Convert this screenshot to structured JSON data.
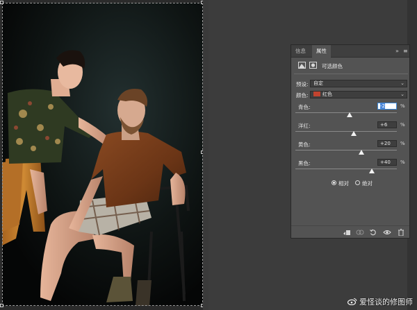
{
  "panel": {
    "tabs": [
      "信息",
      "属性"
    ],
    "active_tab": "属性",
    "menu_glyphs": {
      "collapse": "»",
      "menu": "≡"
    },
    "title": "可选颜色",
    "preset_label": "预设:",
    "preset_value": "自定",
    "colors_label": "颜色:",
    "colors_value": "红色",
    "color_swatch": "#c1432f",
    "sliders": [
      {
        "label": "青色:",
        "value": "-2",
        "unit": "%",
        "position": -2,
        "active": true
      },
      {
        "label": "洋红:",
        "value": "+6",
        "unit": "%",
        "position": 6,
        "active": false
      },
      {
        "label": "黄色:",
        "value": "+20",
        "unit": "%",
        "position": 20,
        "active": false
      },
      {
        "label": "黑色:",
        "value": "+40",
        "unit": "%",
        "position": 40,
        "active": false
      }
    ],
    "method": {
      "relative": "相对",
      "absolute": "绝对",
      "selected": "relative"
    },
    "footer_icons": [
      "clip-to-layer-icon",
      "view-previous-icon",
      "reset-icon",
      "visibility-icon",
      "trash-icon"
    ]
  },
  "watermark": {
    "text": "爱怪谈的修图师"
  }
}
